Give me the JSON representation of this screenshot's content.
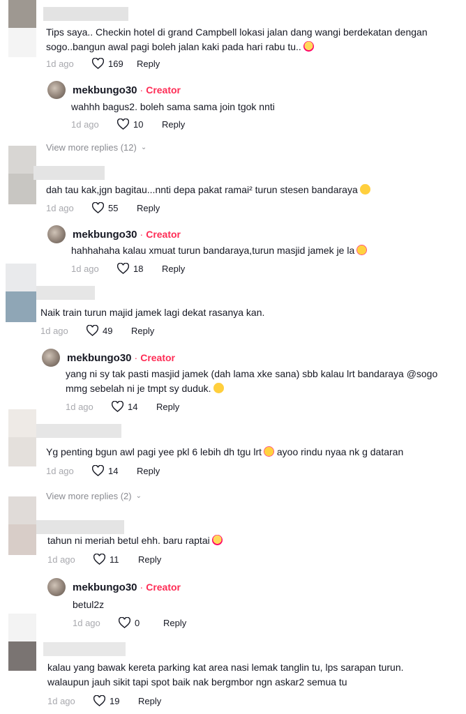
{
  "comments": [
    {
      "text_lines": [
        "Tips saya.. Checkin hotel di grand Campbell lokasi jalan dang wangi berdekatan dengan",
        "sogo..bangun awal pagi boleh jalan kaki pada hari rabu tu.."
      ],
      "time": "1d ago",
      "likes": "169",
      "reply": "Reply",
      "creator_reply": {
        "name": "mekbungo30",
        "sep": "·",
        "badge": "Creator",
        "text_lines": [
          "wahhh bagus2. boleh sama sama join tgok nnti"
        ],
        "time": "1d ago",
        "likes": "10",
        "reply": "Reply"
      },
      "view_more": "View more replies (12)"
    },
    {
      "text_lines": [
        "dah tau kak,jgn bagitau...nnti depa pakat ramai² turun stesen bandaraya"
      ],
      "time": "1d ago",
      "likes": "55",
      "reply": "Reply",
      "creator_reply": {
        "name": "mekbungo30",
        "sep": "·",
        "badge": "Creator",
        "text_lines": [
          "hahhahaha kalau xmuat turun bandaraya,turun masjid jamek je la"
        ],
        "time": "1d ago",
        "likes": "18",
        "reply": "Reply"
      }
    },
    {
      "text_lines": [
        "Naik train turun majid jamek lagi dekat rasanya kan."
      ],
      "time": "1d ago",
      "likes": "49",
      "reply": "Reply",
      "creator_reply": {
        "name": "mekbungo30",
        "sep": "·",
        "badge": "Creator",
        "text_lines": [
          "yang ni sy tak pasti masjid jamek (dah lama xke sana) sbb kalau lrt bandaraya @sogo",
          "mmg sebelah ni je tmpt sy duduk."
        ],
        "time": "1d ago",
        "likes": "14",
        "reply": "Reply"
      }
    },
    {
      "text_lines": [
        "Yg penting bgun awl pagi yee pkl 6 lebih dh tgu lrt",
        "ayoo rindu nyaa nk g dataran"
      ],
      "time": "1d ago",
      "likes": "14",
      "reply": "Reply",
      "view_more": "View more replies (2)"
    },
    {
      "text_lines": [
        "tahun ni meriah betul ehh. baru raptai"
      ],
      "time": "1d ago",
      "likes": "11",
      "reply": "Reply",
      "creator_reply": {
        "name": "mekbungo30",
        "sep": "·",
        "badge": "Creator",
        "text_lines": [
          "betul2z"
        ],
        "time": "1d ago",
        "likes": "0",
        "reply": "Reply"
      }
    },
    {
      "text_lines": [
        "kalau yang bawak kereta parking kat area nasi lemak tanglin tu, lps sarapan turun.",
        "walaupun jauh sikit tapi spot baik nak bergmbor ngn askar2 semua tu"
      ],
      "time": "1d ago",
      "likes": "19",
      "reply": "Reply"
    }
  ],
  "colors": {
    "text": "#161823",
    "muted": "#8a8b91",
    "creator": "#fe2c55",
    "blur": "#d9d9d9"
  },
  "icons": {
    "like": "heart-outline-icon",
    "chevron": "chevron-down-icon"
  }
}
